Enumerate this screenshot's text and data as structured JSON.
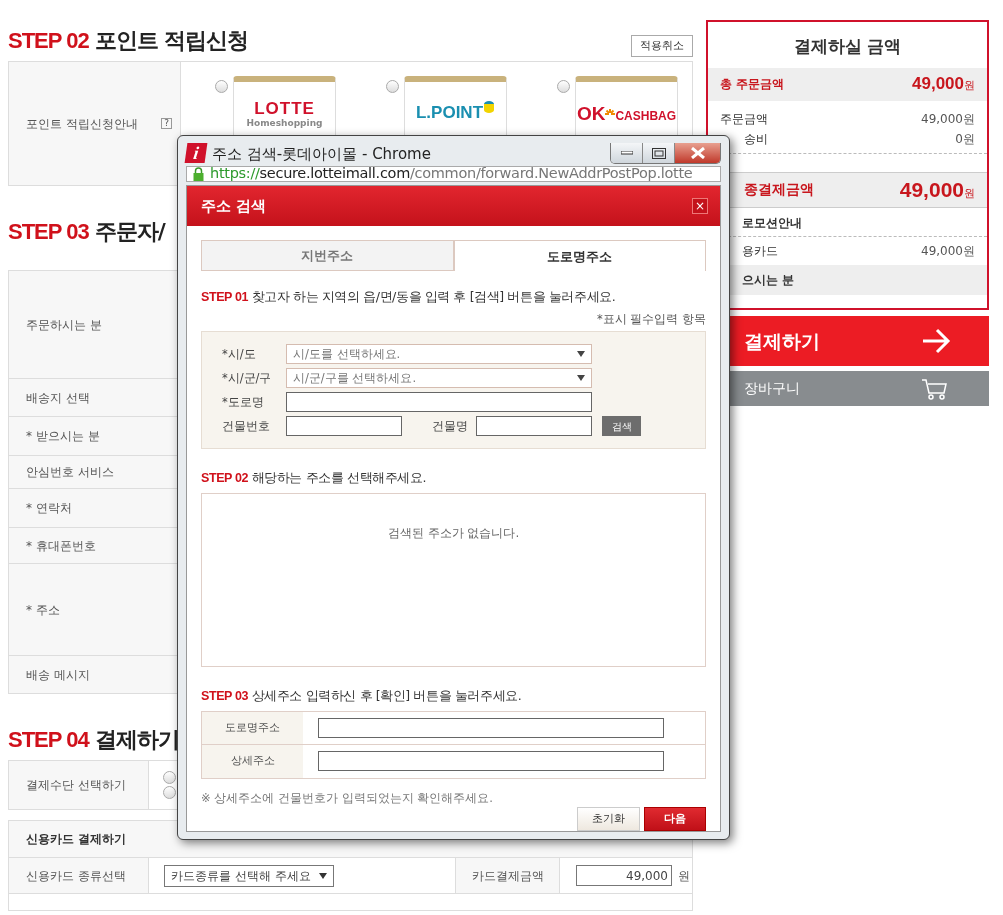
{
  "step02": {
    "step": "STEP 02",
    "title": "포인트 적립신청",
    "cancel_button": "적용취소",
    "label": "포인트 적립신청안내",
    "help": "?",
    "options": [
      {
        "kind": "lotte",
        "name": "LOTTE",
        "sub": "Homeshopping",
        "selected": false
      },
      {
        "kind": "lpoint",
        "name": "L.POINT",
        "selected": false
      },
      {
        "kind": "okcashbag",
        "name": "OK",
        "sub": "CASHBAG",
        "selected": false
      }
    ]
  },
  "step03": {
    "step": "STEP 03",
    "title": "주문자/",
    "rows": [
      {
        "label": "주문하시는 분"
      },
      {
        "label": "배송지 선택"
      },
      {
        "label": "* 받으시는 분"
      },
      {
        "label": "안심번호 서비스"
      },
      {
        "label": "* 연락처"
      },
      {
        "label": "* 휴대폰번호"
      },
      {
        "label": "* 주소"
      },
      {
        "label": "배송 메시지"
      }
    ]
  },
  "step04": {
    "step": "STEP 04",
    "title": "결제하기",
    "method_label": "결제수단 선택하기",
    "methods": [
      {
        "selected": false
      },
      {
        "selected": false
      }
    ],
    "card_title": "신용카드 결제하기",
    "card_type_label": "신용카드 종류선택",
    "card_type_select": "카드종류를 선택해 주세요",
    "card_amount_label": "카드결제금액",
    "card_amount": "49,000",
    "card_amount_unit": "원"
  },
  "summary": {
    "title": "결제하실 금액",
    "total": {
      "label": "총 주문금액",
      "amount": "49,000",
      "unit": "원"
    },
    "lines": [
      {
        "label": "주문금액",
        "value": "49,000원"
      },
      {
        "label": "송비",
        "value": "0원"
      }
    ],
    "final": {
      "label": "종결제금액",
      "amount": "49,000",
      "unit": "원"
    },
    "promo_label": "로모션안내",
    "promo_lines": [
      {
        "label": "용카드",
        "value": "49,000원"
      }
    ],
    "recipient_label": "으시는 분"
  },
  "pay_button": "결제하기",
  "cart_button": "장바구니",
  "popup": {
    "app_icon": "i",
    "title": "주소 검색-롯데아이몰 - Chrome",
    "url": {
      "scheme": "https://",
      "host": "secure.lotteimall.com",
      "path": "/common/forward.NewAddrPostPop.lotte"
    },
    "header": "주소 검색",
    "close": "×",
    "tabs": [
      {
        "label": "지번주소",
        "selected": false
      },
      {
        "label": "도로명주소",
        "selected": true
      }
    ],
    "step1": {
      "step": "STEP 01",
      "text": "찾고자 하는 지역의 읍/면/동을 입력 후 [검색] 버튼을 눌러주세요."
    },
    "required_note": "*표시 필수입력 항목",
    "fields": [
      {
        "kind": "select",
        "label": "*시/도",
        "placeholder": "시/도를 선택하세요."
      },
      {
        "kind": "select",
        "label": "*시/군/구",
        "placeholder": "시/군/구를 선택하세요."
      },
      {
        "kind": "input",
        "label": "*도로명"
      }
    ],
    "building_number_label": "건물번호",
    "building_name_label": "건물명",
    "search_button": "검색",
    "step2": {
      "step": "STEP 02",
      "text": "해당하는 주소를 선택해주세요."
    },
    "empty_message": "검색된 주소가 없습니다.",
    "step3": {
      "step": "STEP 03",
      "text": "상세주소 입력하신 후 [확인] 버튼을 눌러주세요."
    },
    "detail_rows": [
      {
        "label": "도로명주소"
      },
      {
        "label": "상세주소"
      }
    ],
    "note": "※ 상세주소에 건물번호가 입력되었는지 확인해주세요.",
    "reset_button": "초기화",
    "next_button": "다음"
  }
}
